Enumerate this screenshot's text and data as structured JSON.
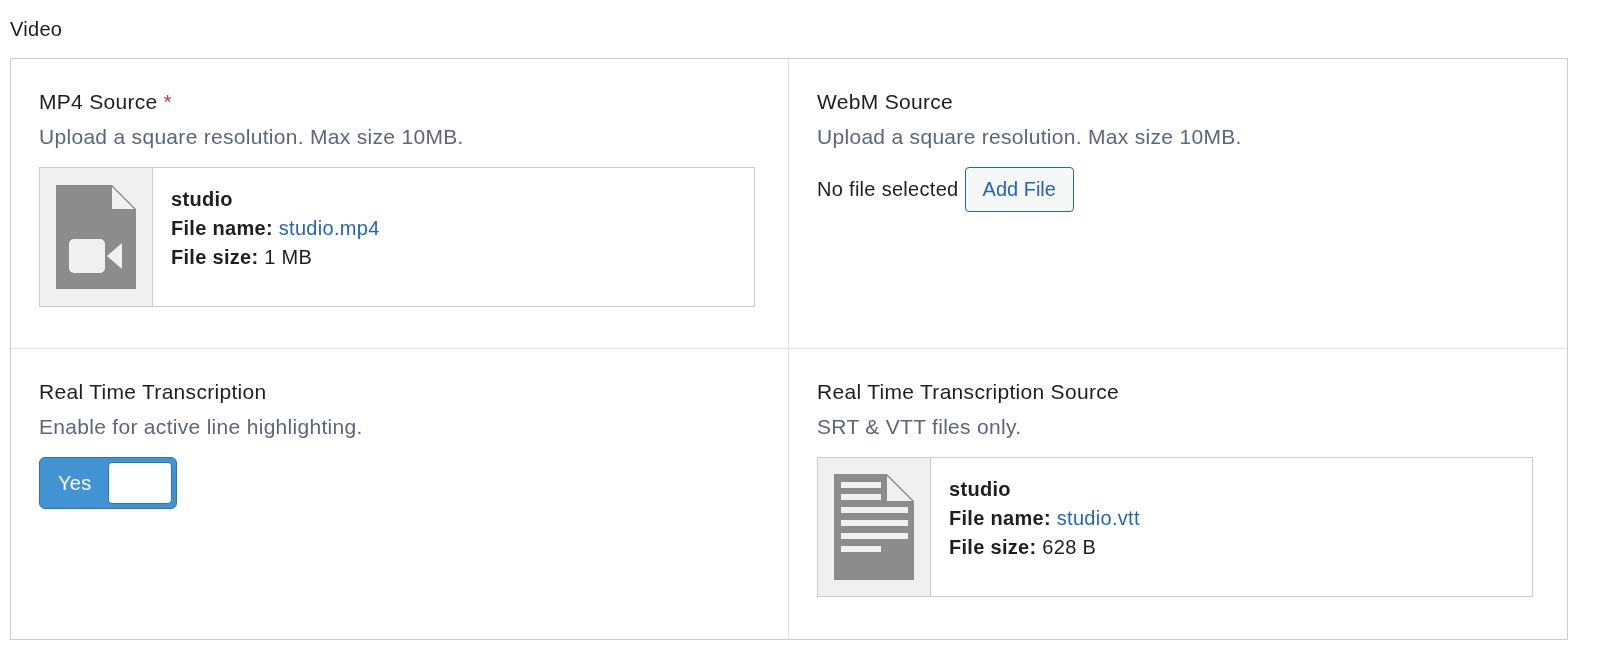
{
  "section_title": "Video",
  "fields": [
    {
      "kind": "file",
      "label": "MP4 Source",
      "required_mark": "*",
      "description": "Upload a square resolution. Max size 10MB.",
      "file": {
        "kind": "video",
        "title": "studio",
        "name_label": "File name:",
        "name": "studio.mp4",
        "size_label": "File size:",
        "size": "1 MB"
      }
    },
    {
      "kind": "empty",
      "label": "WebM Source",
      "description": "Upload a square resolution. Max size 10MB.",
      "empty_text": "No file selected",
      "button": "Add File"
    },
    {
      "kind": "toggle",
      "label": "Real Time Transcription",
      "description": "Enable for active line highlighting.",
      "toggle": {
        "on": true,
        "label": "Yes"
      }
    },
    {
      "kind": "file",
      "label": "Real Time Transcription Source",
      "description": "SRT & VTT files only.",
      "file": {
        "kind": "text",
        "title": "studio",
        "name_label": "File name:",
        "name": "studio.vtt",
        "size_label": "File size:",
        "size": "628 B"
      }
    }
  ]
}
